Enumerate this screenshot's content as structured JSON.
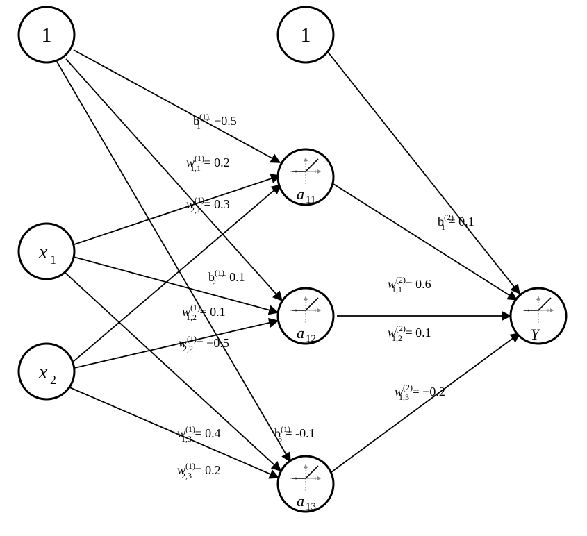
{
  "diagram": {
    "type": "neural-network",
    "layers": [
      {
        "name": "input",
        "nodes": [
          {
            "id": "bias1",
            "label": "1",
            "is_bias": true
          },
          {
            "id": "x1",
            "label": "x",
            "sub": "1"
          },
          {
            "id": "x2",
            "label": "x",
            "sub": "2"
          }
        ]
      },
      {
        "name": "hidden",
        "nodes": [
          {
            "id": "bias2",
            "label": "1",
            "is_bias": true
          },
          {
            "id": "a11",
            "label": "a",
            "sub": "11",
            "activation": "relu"
          },
          {
            "id": "a12",
            "label": "a",
            "sub": "12",
            "activation": "relu"
          },
          {
            "id": "a13",
            "label": "a",
            "sub": "13",
            "activation": "relu"
          }
        ]
      },
      {
        "name": "output",
        "nodes": [
          {
            "id": "Y",
            "label": "Y",
            "activation": "relu"
          }
        ]
      }
    ],
    "weights_layer1": {
      "b1": {
        "text_prefix": "b",
        "sup": "(1)",
        "sub": "1",
        "eq": " = −0.5",
        "value": -0.5
      },
      "w11": {
        "text_prefix": "w",
        "sup": "(1)",
        "sub": "1,1",
        "eq": " = 0.2",
        "value": 0.2
      },
      "w21": {
        "text_prefix": "w",
        "sup": "(1)",
        "sub": "2,1",
        "eq": " = 0.3",
        "value": 0.3
      },
      "b2": {
        "text_prefix": "b",
        "sup": "(1)",
        "sub": "2",
        "eq": " = 0.1",
        "value": 0.1
      },
      "w12": {
        "text_prefix": "w",
        "sup": "(1)",
        "sub": "1,2",
        "eq": " = 0.1",
        "value": 0.1
      },
      "w22": {
        "text_prefix": "w",
        "sup": "(1)",
        "sub": "2,2",
        "eq": " = −0.5",
        "value": -0.5
      },
      "w13": {
        "text_prefix": "w",
        "sup": "(1)",
        "sub": "1,3",
        "eq": " = 0.4",
        "value": 0.4
      },
      "b3": {
        "text_prefix": "b",
        "sup": "(1)",
        "sub": "3",
        "eq": " = -0.1",
        "value": -0.1
      },
      "w23": {
        "text_prefix": "w",
        "sup": "(1)",
        "sub": "2,3",
        "eq": " = 0.2",
        "value": 0.2
      }
    },
    "weights_layer2": {
      "b1": {
        "text_prefix": "b",
        "sup": "(2)",
        "sub": "1",
        "eq": " = 0.1",
        "value": 0.1
      },
      "w11": {
        "text_prefix": "w",
        "sup": "(2)",
        "sub": "1,1",
        "eq": " = 0.6",
        "value": 0.6
      },
      "w12": {
        "text_prefix": "w",
        "sup": "(2)",
        "sub": "1,2",
        "eq": " = 0.1",
        "value": 0.1
      },
      "w13": {
        "text_prefix": "w",
        "sup": "(2)",
        "sub": "1,3",
        "eq": " = −0.2",
        "value": -0.2
      }
    }
  },
  "chart_data": {
    "type": "network",
    "title": "",
    "nodes": [
      {
        "id": "bias1",
        "layer": 0,
        "label": "1"
      },
      {
        "id": "x1",
        "layer": 0,
        "label": "x1"
      },
      {
        "id": "x2",
        "layer": 0,
        "label": "x2"
      },
      {
        "id": "bias2",
        "layer": 1,
        "label": "1"
      },
      {
        "id": "a11",
        "layer": 1,
        "label": "a11"
      },
      {
        "id": "a12",
        "layer": 1,
        "label": "a12"
      },
      {
        "id": "a13",
        "layer": 1,
        "label": "a13"
      },
      {
        "id": "Y",
        "layer": 2,
        "label": "Y"
      }
    ],
    "edges": [
      {
        "from": "bias1",
        "to": "a11",
        "weight": -0.5,
        "param": "b1^(1)"
      },
      {
        "from": "bias1",
        "to": "a12",
        "weight": 0.1,
        "param": "b2^(1)"
      },
      {
        "from": "bias1",
        "to": "a13",
        "weight": -0.1,
        "param": "b3^(1)"
      },
      {
        "from": "x1",
        "to": "a11",
        "weight": 0.2,
        "param": "w1,1^(1)"
      },
      {
        "from": "x1",
        "to": "a12",
        "weight": 0.1,
        "param": "w1,2^(1)"
      },
      {
        "from": "x1",
        "to": "a13",
        "weight": 0.4,
        "param": "w1,3^(1)"
      },
      {
        "from": "x2",
        "to": "a11",
        "weight": 0.3,
        "param": "w2,1^(1)"
      },
      {
        "from": "x2",
        "to": "a12",
        "weight": -0.5,
        "param": "w2,2^(1)"
      },
      {
        "from": "x2",
        "to": "a13",
        "weight": 0.2,
        "param": "w2,3^(1)"
      },
      {
        "from": "bias2",
        "to": "Y",
        "weight": 0.1,
        "param": "b1^(2)"
      },
      {
        "from": "a11",
        "to": "Y",
        "weight": 0.6,
        "param": "w1,1^(2)"
      },
      {
        "from": "a12",
        "to": "Y",
        "weight": 0.1,
        "param": "w1,2^(2)"
      },
      {
        "from": "a13",
        "to": "Y",
        "weight": -0.2,
        "param": "w1,3^(2)"
      }
    ]
  }
}
